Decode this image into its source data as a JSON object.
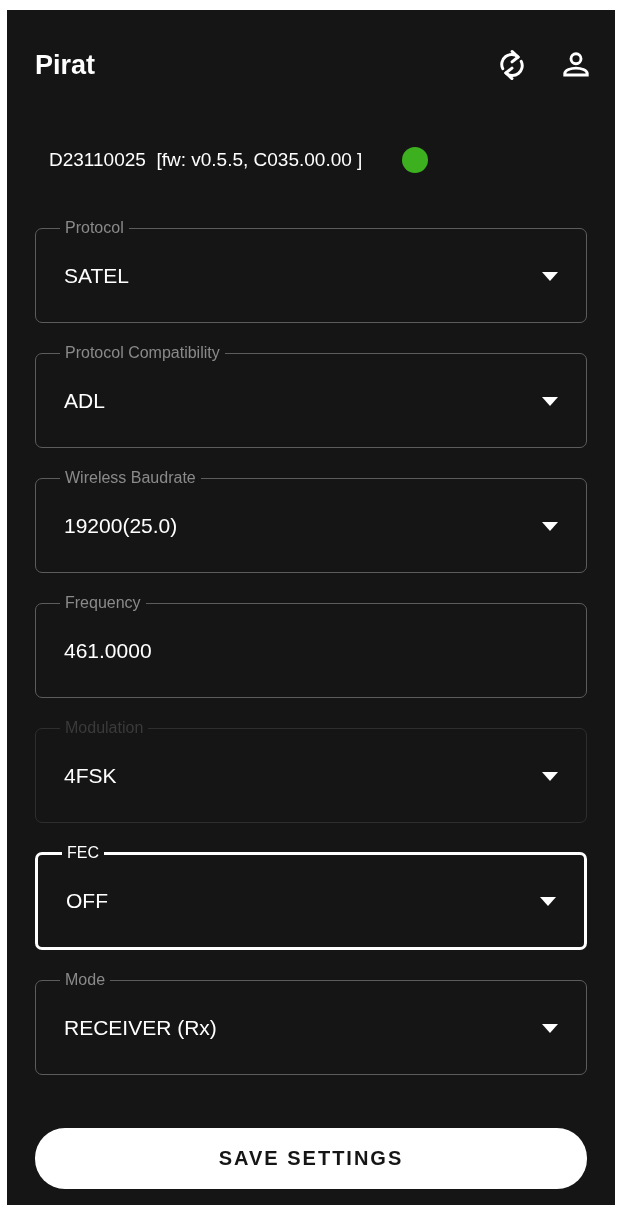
{
  "app_bar": {
    "title": "Pirat"
  },
  "device": {
    "info": "D23110025  [fw: v0.5.5, C035.00.00 ]",
    "status": {
      "color": "#3cb01e"
    }
  },
  "fields": [
    {
      "kind": "select",
      "label": "Protocol",
      "value": "SATEL",
      "disabled": false,
      "focused": false
    },
    {
      "kind": "select",
      "label": "Protocol Compatibility",
      "value": "ADL",
      "disabled": false,
      "focused": false
    },
    {
      "kind": "select",
      "label": "Wireless Baudrate",
      "value": "19200(25.0)",
      "disabled": false,
      "focused": false
    },
    {
      "kind": "text",
      "label": "Frequency",
      "value": "461.0000",
      "disabled": false,
      "focused": false
    },
    {
      "kind": "select",
      "label": "Modulation",
      "value": "4FSK",
      "disabled": true,
      "focused": false
    },
    {
      "kind": "select",
      "label": "FEC",
      "value": "OFF",
      "disabled": false,
      "focused": true
    },
    {
      "kind": "select",
      "label": "Mode",
      "value": "RECEIVER (Rx)",
      "disabled": false,
      "focused": false
    }
  ],
  "save_button": {
    "label": "SAVE SETTINGS"
  }
}
